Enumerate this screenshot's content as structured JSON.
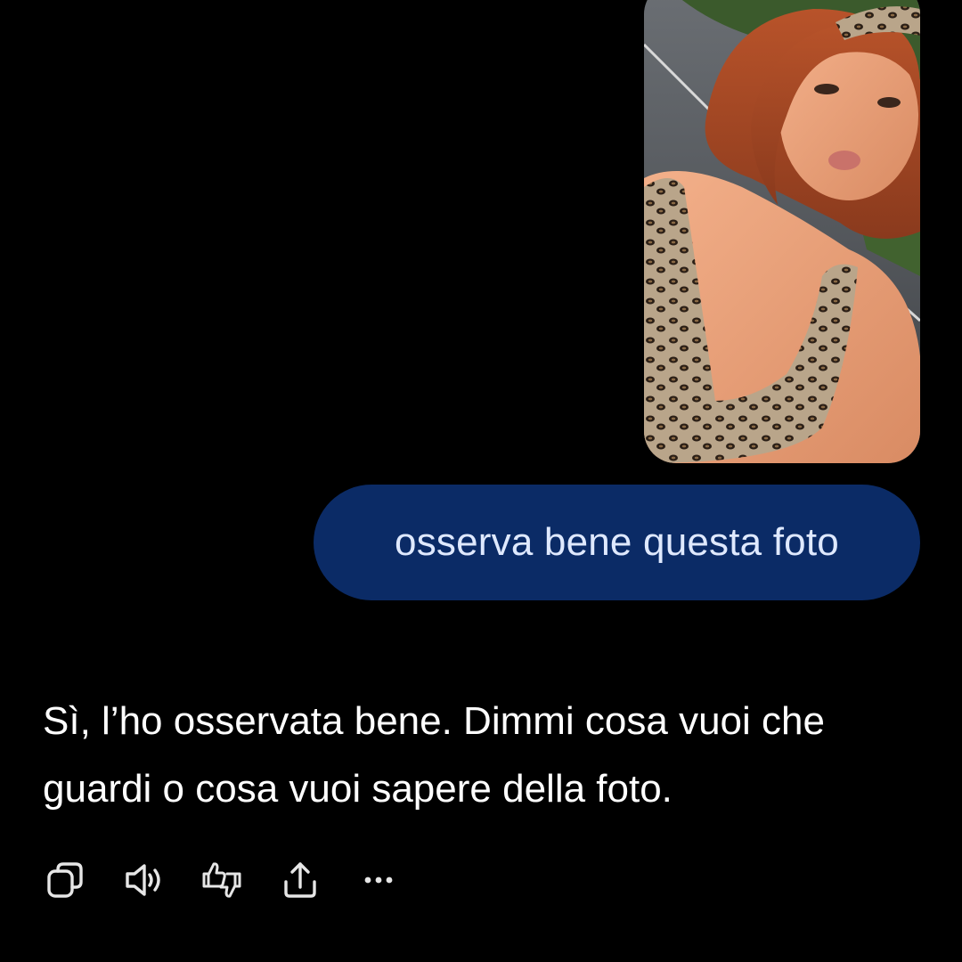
{
  "conversation": {
    "user_image": {
      "alt": "foto allegata"
    },
    "user_message": "osserva bene questa foto",
    "assistant_message": "Sì, l’ho osservata bene. Dimmi cosa vuoi che guardi o cosa vuoi sapere della foto."
  },
  "message_actions": [
    {
      "name": "copy-icon"
    },
    {
      "name": "read-aloud-icon"
    },
    {
      "name": "feedback-thumbs-icon"
    },
    {
      "name": "share-icon"
    },
    {
      "name": "more-icon"
    }
  ],
  "colors": {
    "background": "#000000",
    "user_bubble": "#0b2b66",
    "user_text": "#dfe9ff",
    "assistant_text": "#ffffff",
    "icon": "#e6e6e6"
  }
}
